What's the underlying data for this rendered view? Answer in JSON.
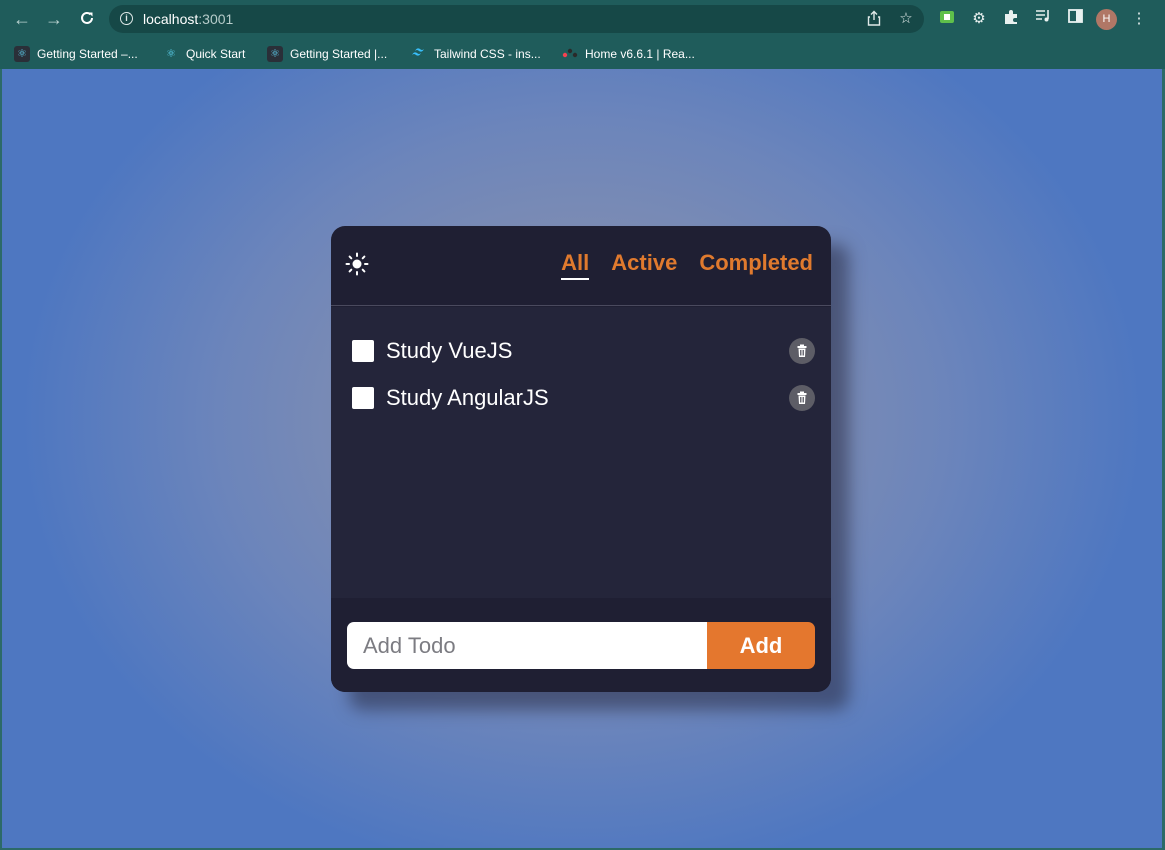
{
  "browser": {
    "url_host": "localhost",
    "url_port": ":3001",
    "profile_initial": "H",
    "bookmarks": [
      {
        "label": "Getting Started –...",
        "icon": "react-icon"
      },
      {
        "label": "Quick Start",
        "icon": "react-icon"
      },
      {
        "label": "Getting Started |...",
        "icon": "react-icon"
      },
      {
        "label": "Tailwind CSS - ins...",
        "icon": "tailwind-icon"
      },
      {
        "label": "Home v6.6.1 | Rea...",
        "icon": "react-router-icon"
      }
    ]
  },
  "app": {
    "theme_icon": "sun-icon",
    "filters": [
      {
        "label": "All",
        "selected": true
      },
      {
        "label": "Active",
        "selected": false
      },
      {
        "label": "Completed",
        "selected": false
      }
    ],
    "todos": [
      {
        "text": "Study VueJS",
        "completed": false
      },
      {
        "text": "Study AngularJS",
        "completed": false
      }
    ],
    "add_placeholder": "Add Todo",
    "add_label": "Add"
  },
  "colors": {
    "accent": "#e4772e",
    "card_background": "#1f1f33",
    "list_background": "#24253a",
    "browser_frame": "#1f5c5b"
  }
}
